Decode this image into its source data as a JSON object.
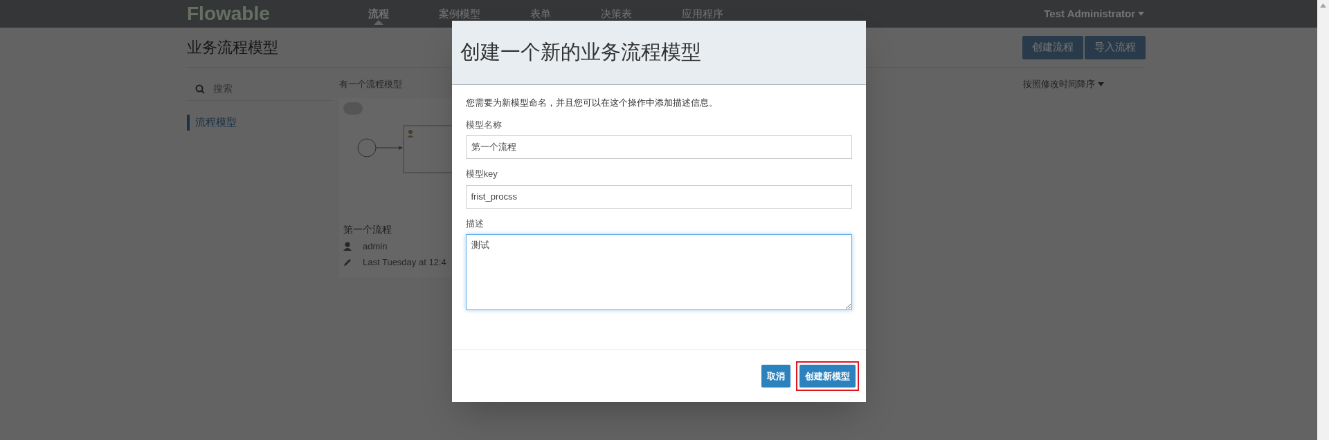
{
  "navbar": {
    "logo": "Flowable",
    "items": [
      {
        "label": "流程",
        "selected": true
      },
      {
        "label": "案例模型",
        "selected": false
      },
      {
        "label": "表单",
        "selected": false
      },
      {
        "label": "决策表",
        "selected": false
      },
      {
        "label": "应用程序",
        "selected": false
      }
    ],
    "user": "Test Administrator"
  },
  "page": {
    "title": "业务流程模型",
    "actions": [
      "创建流程",
      "导入流程"
    ],
    "search": {
      "placeholder": "搜索"
    },
    "sidebar": [
      {
        "label": "流程模型",
        "selected": true
      }
    ],
    "count_text": "有一个流程模型",
    "sort": "按照修改时间降序",
    "models": [
      {
        "name": "第一个流程",
        "author": "admin",
        "modified": "Last Tuesday at 12:4"
      }
    ]
  },
  "dialog": {
    "title": "创建一个新的业务流程模型",
    "description": "您需要为新模型命名，并且您可以在这个操作中添加描述信息。",
    "fields": [
      {
        "kind": "input",
        "label": "模型名称",
        "value": "第一个流程",
        "focused": false
      },
      {
        "kind": "input",
        "label": "模型key",
        "value": "frist_procss",
        "focused": false
      },
      {
        "kind": "textarea",
        "label": "描述",
        "value": "测试",
        "focused": true
      }
    ],
    "buttons": [
      {
        "label": "取消",
        "highlighted": false
      },
      {
        "label": "创建新模型",
        "highlighted": true
      }
    ]
  }
}
